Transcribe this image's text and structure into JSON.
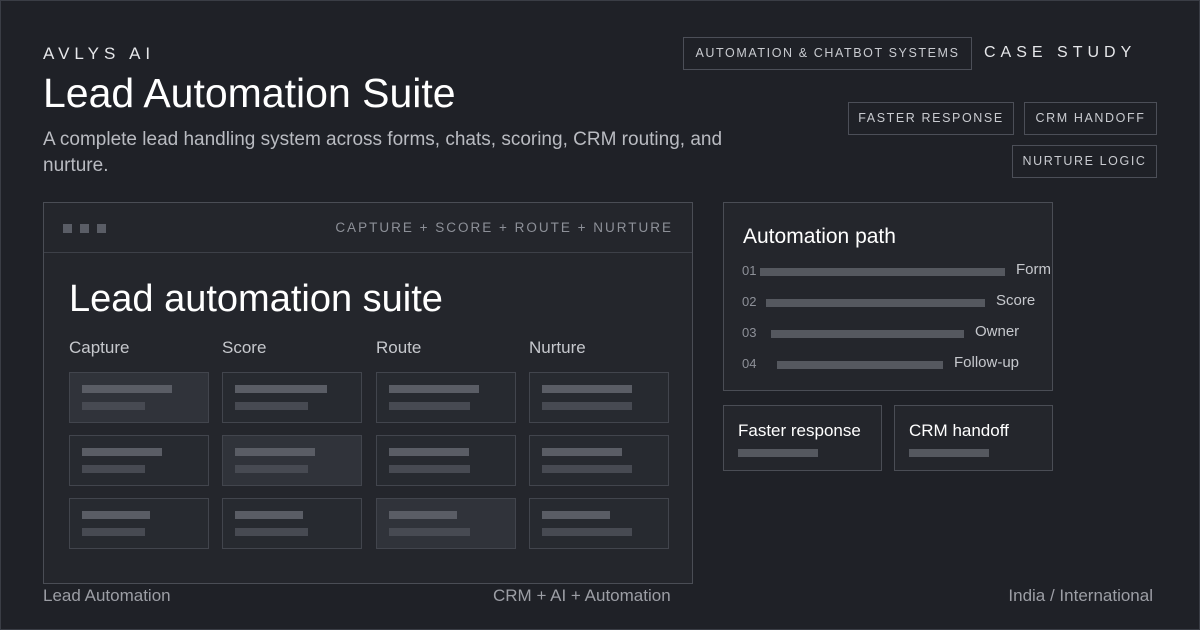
{
  "brand": "AVLYS AI",
  "title": "Lead Automation Suite",
  "subtitle": "A complete lead handling system across forms, chats, scoring, CRM routing, and nurture.",
  "header": {
    "category_tag": "AUTOMATION & CHATBOT SYSTEMS",
    "case_study": "CASE STUDY"
  },
  "tags": [
    "FASTER RESPONSE",
    "CRM HANDOFF",
    "NURTURE LOGIC"
  ],
  "window": {
    "caption": "CAPTURE + SCORE + ROUTE + NURTURE",
    "title": "Lead automation suite",
    "columns": [
      "Capture",
      "Score",
      "Route",
      "Nurture"
    ]
  },
  "automation_path": {
    "title": "Automation path",
    "steps": [
      {
        "number": "01",
        "label": "Form"
      },
      {
        "number": "02",
        "label": "Score"
      },
      {
        "number": "03",
        "label": "Owner"
      },
      {
        "number": "04",
        "label": "Follow-up"
      }
    ]
  },
  "features": [
    "Faster response",
    "CRM handoff"
  ],
  "footer": {
    "left": "Lead Automation",
    "center": "CRM + AI + Automation",
    "right": "India / International"
  },
  "colors": {
    "background": "#1f2127",
    "panel": "#24262c",
    "border": "#4a4d55",
    "placeholder_bar": "#55585f"
  }
}
